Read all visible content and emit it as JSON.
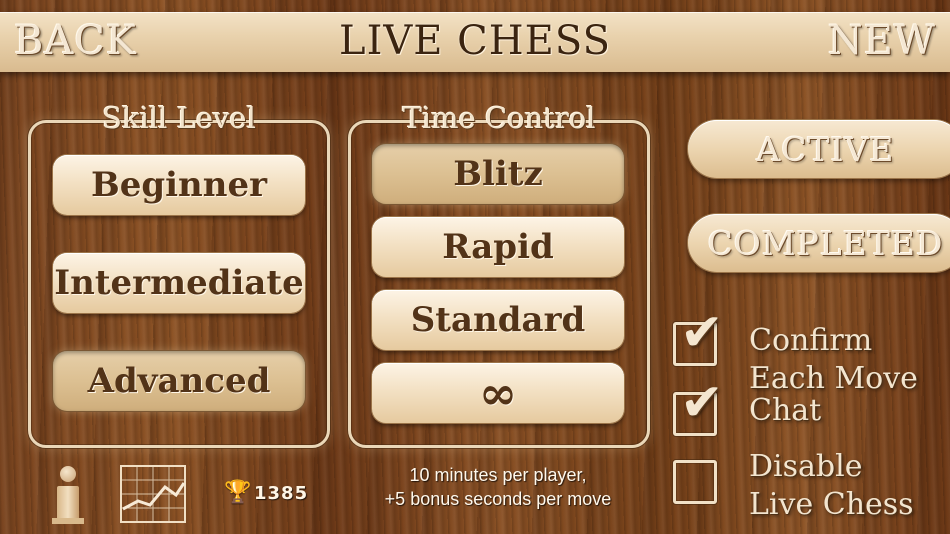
{
  "header": {
    "back_label": "BACK",
    "title": "LIVE CHESS",
    "new_label": "NEW"
  },
  "skill_level": {
    "label": "Skill Level",
    "options": [
      "Beginner",
      "Intermediate",
      "Advanced"
    ],
    "selected": "Advanced"
  },
  "time_control": {
    "label": "Time Control",
    "options": [
      "Blitz",
      "Rapid",
      "Standard",
      "∞"
    ],
    "selected": "Blitz",
    "description_line1": "10 minutes per player,",
    "description_line2": "+5 bonus seconds per move"
  },
  "side_buttons": {
    "active_label": "ACTIVE",
    "completed_label": "COMPLETED"
  },
  "settings": {
    "confirm_move": {
      "line1": "Confirm",
      "line2": "Each Move",
      "checked": true
    },
    "chat": {
      "label": "Chat",
      "checked": true
    },
    "disable_live": {
      "line1": "Disable",
      "line2": "Live Chess",
      "checked": false
    }
  },
  "footer": {
    "rating": "1385",
    "icons": [
      "info-icon",
      "rating-graph-icon",
      "trophy-icon"
    ]
  },
  "colors": {
    "wood": "#8e5426",
    "panel": "#f3e1c4",
    "text_dark": "#523318"
  }
}
